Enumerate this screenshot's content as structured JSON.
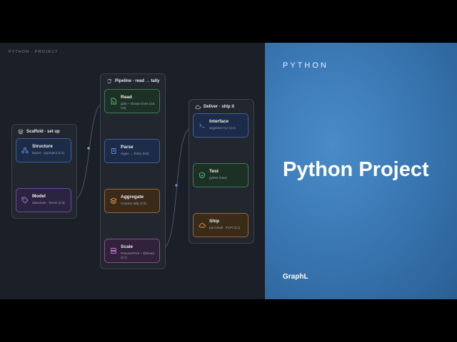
{
  "eyebrow": "PYTHON · PROJECT",
  "groups": {
    "scaffold": {
      "title": "Scaffold · set up"
    },
    "pipeline": {
      "title": "Pipeline · read → tally"
    },
    "deliver": {
      "title": "Deliver · ship it"
    }
  },
  "nodes": {
    "structure": {
      "title": "Structure",
      "sub": "layout · pyproject (C1)",
      "icon": "sitemap-icon"
    },
    "model": {
      "title": "Model",
      "sub": "dataclass · Enum (C4)",
      "icon": "tag-icon"
    },
    "read": {
      "title": "Read",
      "sub": "glob + stream lines (C5, C6)",
      "icon": "file-icon"
    },
    "parse": {
      "title": "Parse",
      "sub": "regex → Entry (C6)",
      "icon": "scroll-icon"
    },
    "aggregate": {
      "title": "Aggregate",
      "sub": "Counter tally (C3)",
      "icon": "layers-icon"
    },
    "scale": {
      "title": "Scale",
      "sub": "ProcessPool + @timed (C7)",
      "icon": "server-icon"
    },
    "interface": {
      "title": "Interface",
      "sub": "argparse CLI (C4)",
      "icon": "terminal-icon"
    },
    "test": {
      "title": "Test",
      "sub": "pytest (new)",
      "icon": "shield-check-icon"
    },
    "ship": {
      "title": "Ship",
      "sub": "pip install · PyPI (C1)",
      "icon": "cloud-icon"
    }
  },
  "panel": {
    "kicker": "PYTHON",
    "title": "Python Project",
    "brand": "GraphL"
  },
  "colors": {
    "canvas": "#1b1f27",
    "panel": "#3a78b4",
    "blue": "#5b8de0",
    "purple": "#a07de0",
    "green": "#5cc07a",
    "orange": "#e0954a",
    "pink": "#c07ad0"
  }
}
